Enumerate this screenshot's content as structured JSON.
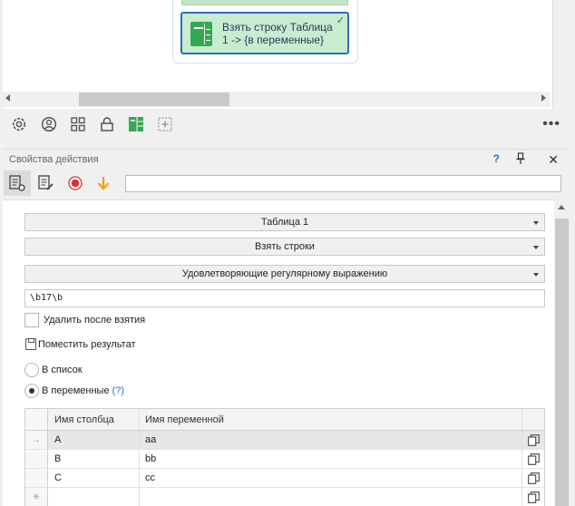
{
  "canvas": {
    "node": {
      "line1": "Взять строку Таблица",
      "line2": "1 -> {в переменные}",
      "check_icon": "checkmark-icon"
    }
  },
  "bottom_toolbar": {
    "icons": [
      "gear-icon",
      "user-icon",
      "grid-icon",
      "lock-icon",
      "table-icon",
      "add-box-icon"
    ],
    "more_label": "•••"
  },
  "panel": {
    "title": "Свойства действия",
    "help_label": "?",
    "pin_label": "⊥",
    "close_label": "✕",
    "toolbar": {
      "icons": [
        "properties-icon",
        "edit-icon",
        "record-icon",
        "arrow-down-icon"
      ],
      "filter_value": ""
    }
  },
  "form": {
    "table_select": "Таблица 1",
    "action_select": "Взять строки",
    "condition_select": "Удовлетворяющие регулярному выражению",
    "regex_value": "\\b17\\b",
    "delete_after_label": "Удалить после взятия",
    "delete_after_checked": false,
    "put_result_label": "Поместить результат",
    "radio_list_label": "В список",
    "radio_vars_label": "В переменные",
    "radio_vars_help": "(?)",
    "selected_radio": "vars"
  },
  "grid": {
    "headers": [
      "Имя столбца",
      "Имя переменной"
    ],
    "rows": [
      {
        "indicator": "→",
        "column": "A",
        "variable": "aa"
      },
      {
        "indicator": "",
        "column": "B",
        "variable": "bb"
      },
      {
        "indicator": "",
        "column": "C",
        "variable": "cc"
      },
      {
        "indicator": "✳",
        "column": "",
        "variable": ""
      }
    ]
  }
}
